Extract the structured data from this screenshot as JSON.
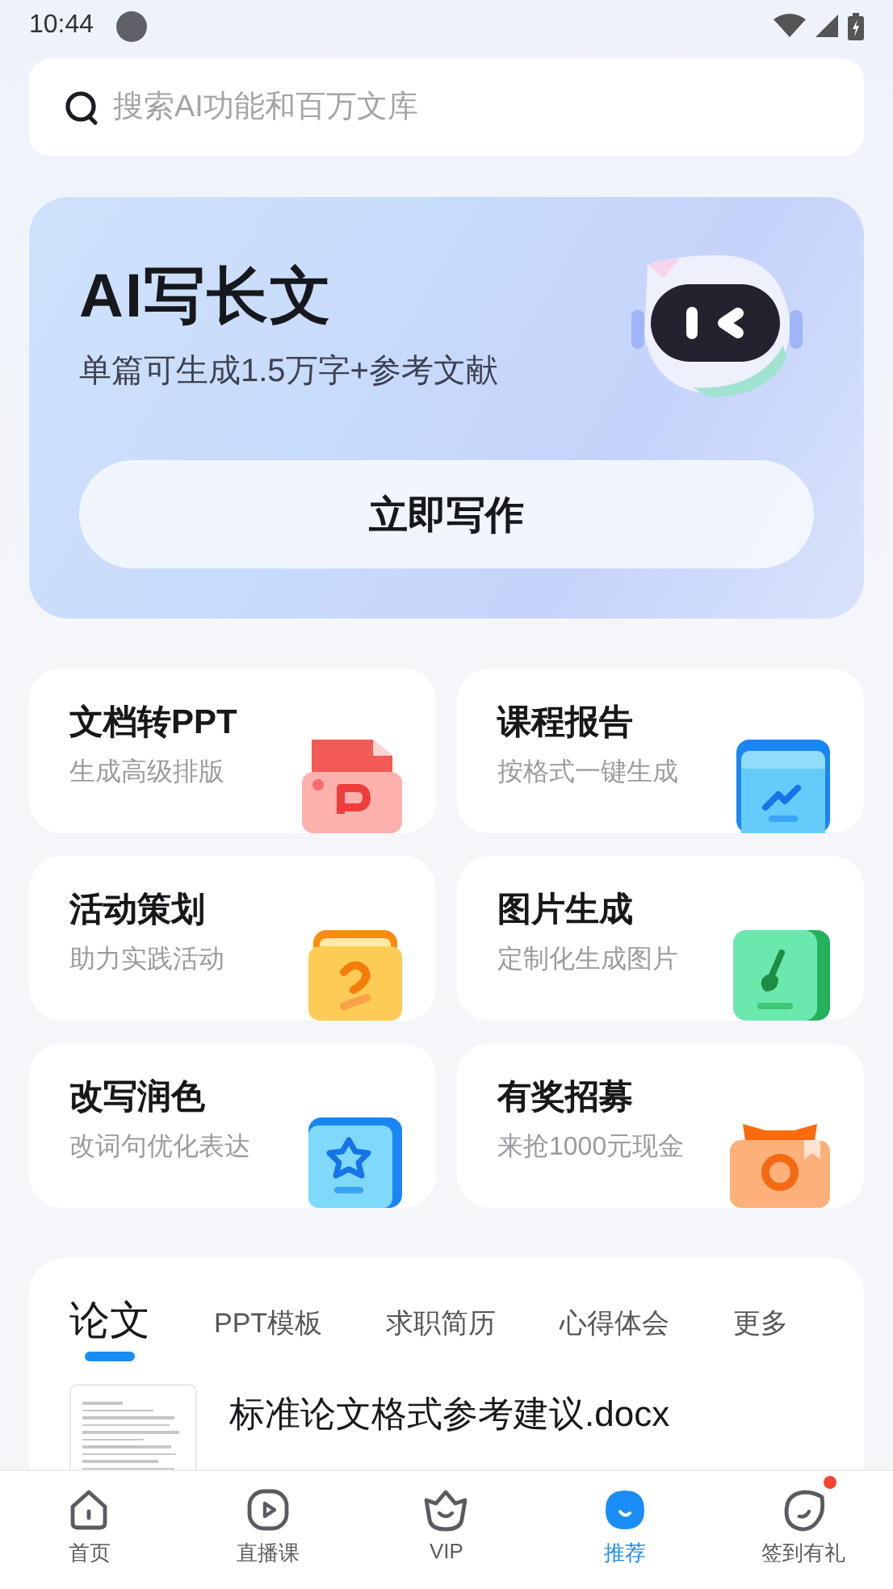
{
  "status_bar": {
    "time": "10:44"
  },
  "search": {
    "placeholder": "搜索AI功能和百万文库"
  },
  "banner": {
    "title": "AI写长文",
    "subtitle": "单篇可生成1.5万字+参考文献",
    "button": "立即写作"
  },
  "tools": [
    {
      "title": "文档转PPT",
      "subtitle": "生成高级排版",
      "kind": "ppt"
    },
    {
      "title": "课程报告",
      "subtitle": "按格式一键生成",
      "kind": "report"
    },
    {
      "title": "活动策划",
      "subtitle": "助力实践活动",
      "kind": "plan"
    },
    {
      "title": "图片生成",
      "subtitle": "定制化生成图片",
      "kind": "image"
    },
    {
      "title": "改写润色",
      "subtitle": "改词句优化表达",
      "kind": "rewrite"
    },
    {
      "title": "有奖招募",
      "subtitle": "来抢1000元现金",
      "kind": "reward"
    }
  ],
  "doc_tabs": [
    {
      "label": "论文",
      "selected": true
    },
    {
      "label": "PPT模板",
      "selected": false
    },
    {
      "label": "求职简历",
      "selected": false
    },
    {
      "label": "心得体会",
      "selected": false
    },
    {
      "label": "更多",
      "selected": false
    }
  ],
  "documents": [
    {
      "title": "标准论文格式参考建议.docx"
    }
  ],
  "bottom_nav": [
    {
      "label": "首页",
      "kind": "home",
      "selected": false,
      "has_notification": false
    },
    {
      "label": "直播课",
      "kind": "live",
      "selected": false,
      "has_notification": false
    },
    {
      "label": "VIP",
      "kind": "vip",
      "selected": false,
      "has_notification": false
    },
    {
      "label": "推荐",
      "kind": "recommend",
      "selected": true,
      "has_notification": false
    },
    {
      "label": "签到有礼",
      "kind": "checkin",
      "selected": false,
      "has_notification": true
    }
  ]
}
